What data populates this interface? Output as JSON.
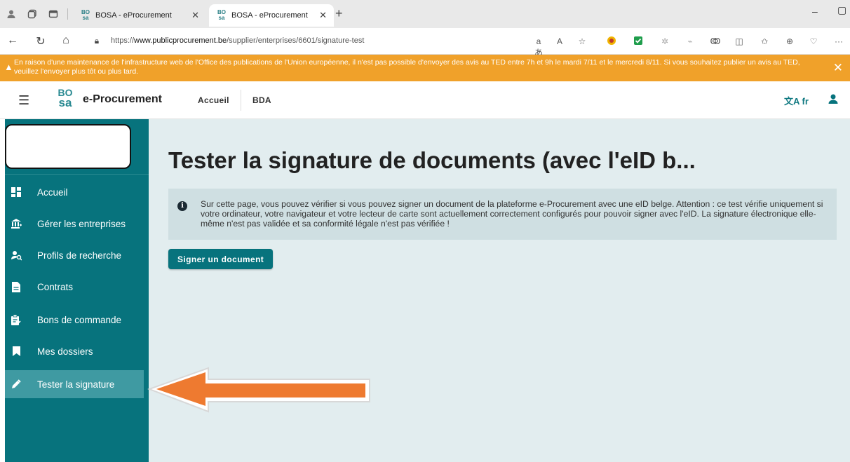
{
  "browser": {
    "tabs": [
      {
        "label": "BOSA - eProcurement",
        "active": false
      },
      {
        "label": "BOSA - eProcurement",
        "active": true
      }
    ],
    "favicon_text": "BO sa",
    "url_prefix": "https://",
    "url_domain": "www.publicprocurement.be",
    "url_path": "/supplier/enterprises/6601/signature-test"
  },
  "banner": {
    "text": "En raison d'une maintenance de l'infrastructure web de l'Office des publications de l'Union européenne, il n'est pas possible d'envoyer des avis au TED entre 7h et 9h le mardi 7/11 et le mercredi 8/11. Si vous souhaitez publier un avis au TED, veuillez l'envoyer plus tôt ou plus tard.",
    "color": "#f0a12a"
  },
  "header": {
    "logo_top": "BO",
    "logo_bottom": "sa",
    "brand": "e-Procurement",
    "nav": [
      "Accueil",
      "BDA"
    ],
    "lang": "fr"
  },
  "sidebar": {
    "items": [
      {
        "label": "Accueil",
        "icon": "dashboard-icon",
        "active": false
      },
      {
        "label": "Gérer les entreprises",
        "icon": "building-icon",
        "active": false
      },
      {
        "label": "Profils de recherche",
        "icon": "user-search-icon",
        "active": false
      },
      {
        "label": "Contrats",
        "icon": "document-icon",
        "active": false
      },
      {
        "label": "Bons de commande",
        "icon": "clipboard-icon",
        "active": false
      },
      {
        "label": "Mes dossiers",
        "icon": "bookmark-icon",
        "active": false
      },
      {
        "label": "Tester la signature",
        "icon": "pen-icon",
        "active": true
      }
    ],
    "color": "#07737d"
  },
  "main": {
    "title": "Tester la signature de documents (avec l'eID b...",
    "info": "Sur cette page, vous pouvez vérifier si vous pouvez signer un document de la plateforme e-Procurement avec une eID belge. Attention : ce test vérifie uniquement si votre ordinateur, votre navigateur et votre lecteur de carte sont actuellement correctement configurés pour pouvoir signer avec l'eID. La signature électronique elle-même n'est pas validée et sa conformité légale n'est pas vérifiée !",
    "sign_button": "Signer un document"
  },
  "annotation": {
    "arrow_color": "#ee7a30"
  }
}
